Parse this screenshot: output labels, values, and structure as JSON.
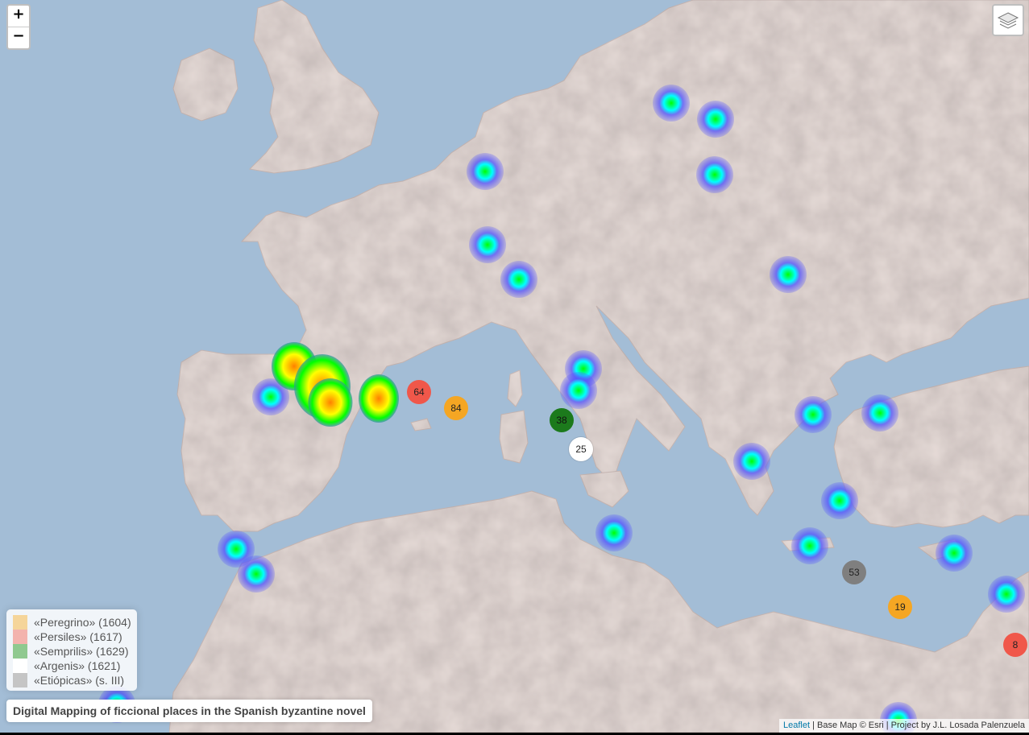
{
  "map": {
    "zoom_in_label": "+",
    "zoom_out_label": "−",
    "layers_icon": "layers-icon",
    "heat_gradient": [
      "#0000ff",
      "#00ffff",
      "#00ff00",
      "#ffff00",
      "#ff8000"
    ],
    "clusters": [
      {
        "count": "64",
        "color": "#f0574a"
      },
      {
        "count": "84",
        "color": "#f5a623"
      },
      {
        "count": "38",
        "color": "#1c7a1c"
      },
      {
        "count": "25",
        "color": "#ffffff"
      },
      {
        "count": "53",
        "color": "#7f7f7f"
      },
      {
        "count": "19",
        "color": "#f5a623"
      },
      {
        "count": "8",
        "color": "#f0574a"
      }
    ]
  },
  "legend": {
    "items": [
      {
        "label": "«Peregrino» (1604)",
        "color": "#f5d59a"
      },
      {
        "label": "«Persiles» (1617)",
        "color": "#f3b3ad"
      },
      {
        "label": "«Semprilis» (1629)",
        "color": "#8fc98f"
      },
      {
        "label": "«Argenis» (1621)",
        "color": "#ffffff"
      },
      {
        "label": "«Etiópicas» (s. III)",
        "color": "#c5c5c5"
      }
    ]
  },
  "title": "Digital Mapping of ficcional places in the Spanish byzantine novel",
  "attribution": {
    "leaflet": "Leaflet",
    "rest": " | Base Map © Esri | Project by J.L. Losada Palenzuela"
  }
}
